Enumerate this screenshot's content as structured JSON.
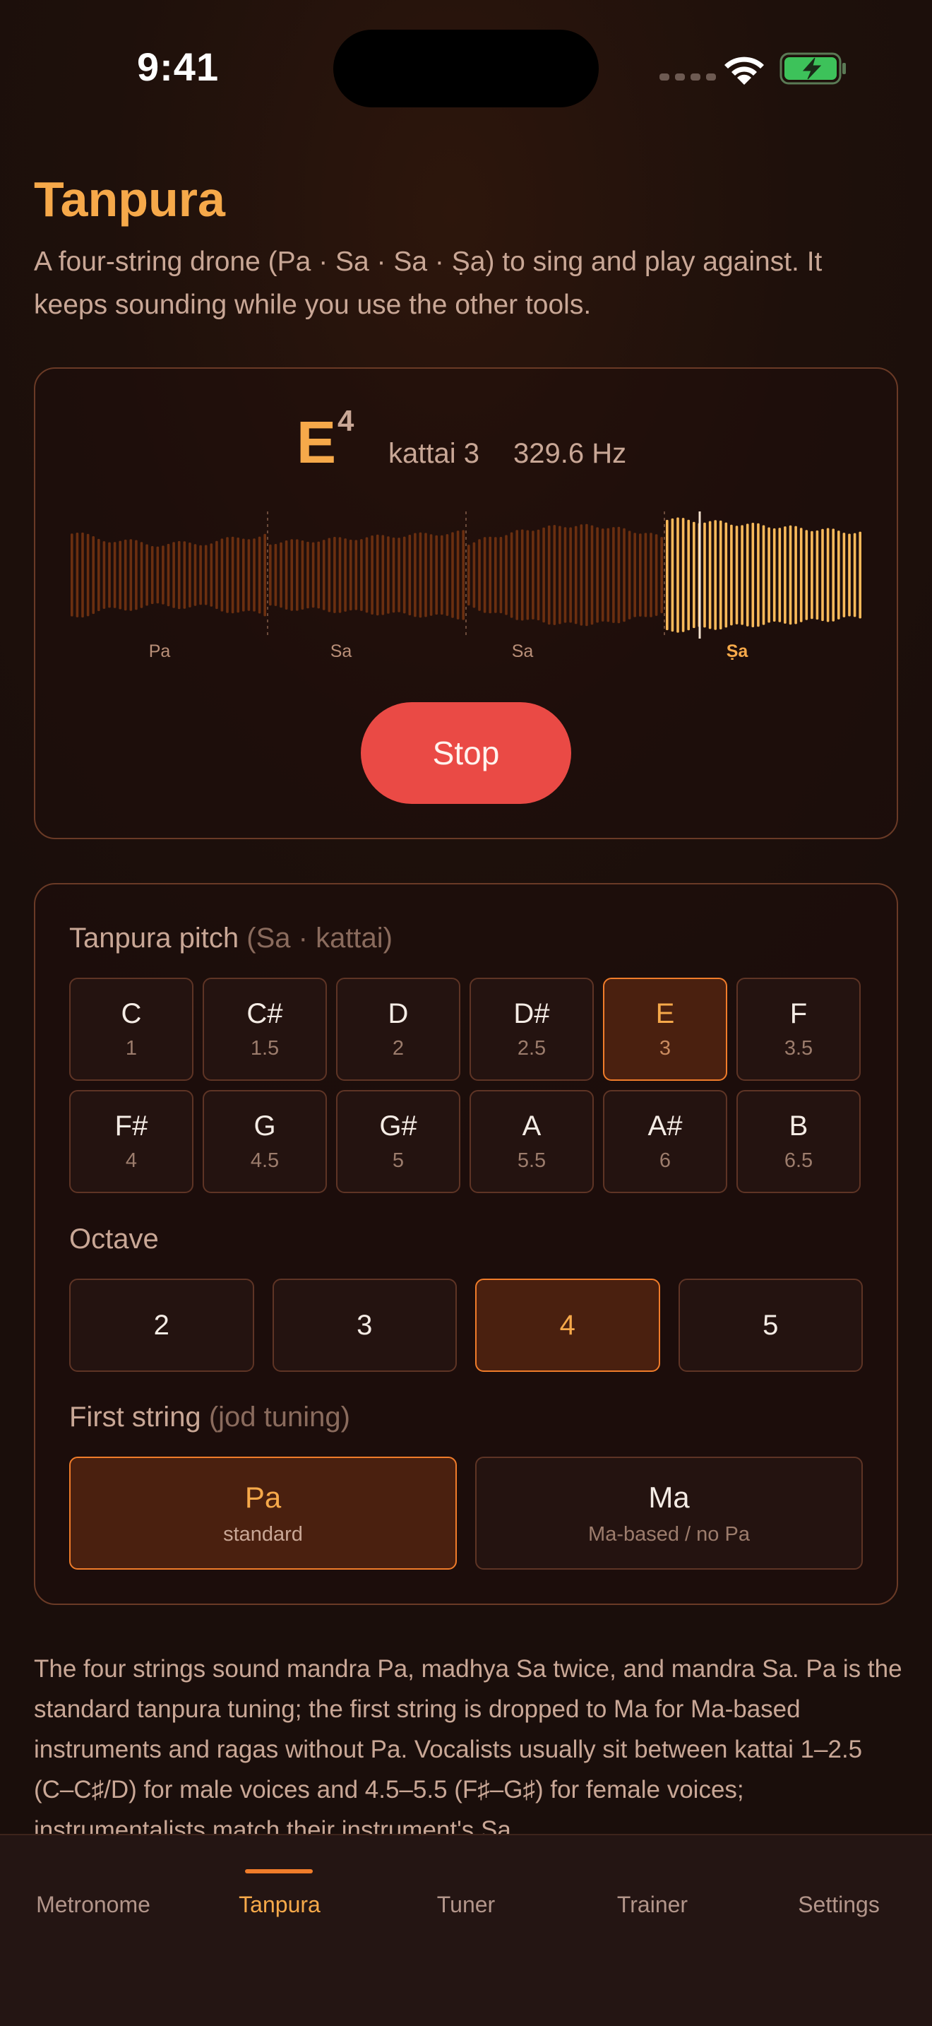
{
  "status_bar": {
    "time": "9:41"
  },
  "page": {
    "title": "Tanpura",
    "description": "A four-string drone (Pa · Sa · Sa · Ṣa) to sing and play against. It keeps sounding while you use the other tools."
  },
  "drone": {
    "note_letter": "E",
    "note_octave": "4",
    "kattai": "kattai 3",
    "frequency": "329.6 Hz",
    "strings": [
      {
        "label": "Pa",
        "active": false
      },
      {
        "label": "Sa",
        "active": false
      },
      {
        "label": "Sa",
        "active": false
      },
      {
        "label": "Ṣa",
        "active": true
      }
    ],
    "stop_label": "Stop"
  },
  "settings": {
    "pitch_label": "Tanpura pitch",
    "pitch_sub": "(Sa · kattai)",
    "pitches": [
      {
        "note": "C",
        "kattai": "1"
      },
      {
        "note": "C#",
        "kattai": "1.5"
      },
      {
        "note": "D",
        "kattai": "2"
      },
      {
        "note": "D#",
        "kattai": "2.5"
      },
      {
        "note": "E",
        "kattai": "3",
        "selected": true
      },
      {
        "note": "F",
        "kattai": "3.5"
      },
      {
        "note": "F#",
        "kattai": "4"
      },
      {
        "note": "G",
        "kattai": "4.5"
      },
      {
        "note": "G#",
        "kattai": "5"
      },
      {
        "note": "A",
        "kattai": "5.5"
      },
      {
        "note": "A#",
        "kattai": "6"
      },
      {
        "note": "B",
        "kattai": "6.5"
      }
    ],
    "octave_label": "Octave",
    "octaves": [
      {
        "label": "2"
      },
      {
        "label": "3"
      },
      {
        "label": "4",
        "selected": true
      },
      {
        "label": "5"
      }
    ],
    "first_string_label": "First string",
    "first_string_sub": "(jod tuning)",
    "first_string_options": [
      {
        "name": "Pa",
        "desc": "standard",
        "selected": true
      },
      {
        "name": "Ma",
        "desc": "Ma-based / no Pa"
      }
    ]
  },
  "info_text": "The four strings sound mandra Pa, madhya Sa twice, and mandra Sa. Pa is the standard tanpura tuning; the first string is dropped to Ma for Ma-based instruments and ragas without Pa. Vocalists usually sit between kattai 1–2.5 (C–C♯/D) for male voices and 4.5–5.5 (F♯–G♯) for female voices; instrumentalists match their instrument's Sa.",
  "tabs": [
    {
      "label": "Metronome"
    },
    {
      "label": "Tanpura",
      "active": true
    },
    {
      "label": "Tuner"
    },
    {
      "label": "Trainer"
    },
    {
      "label": "Settings"
    }
  ],
  "colors": {
    "accent": "#f6a94a",
    "accent_border": "#f07c2a",
    "stop": "#ea4a45",
    "wave_dim": "#6b2f10",
    "wave_active": "#f8b95a"
  },
  "icons": [
    "cellular-signal-icon",
    "wifi-icon",
    "battery-charging-icon"
  ]
}
